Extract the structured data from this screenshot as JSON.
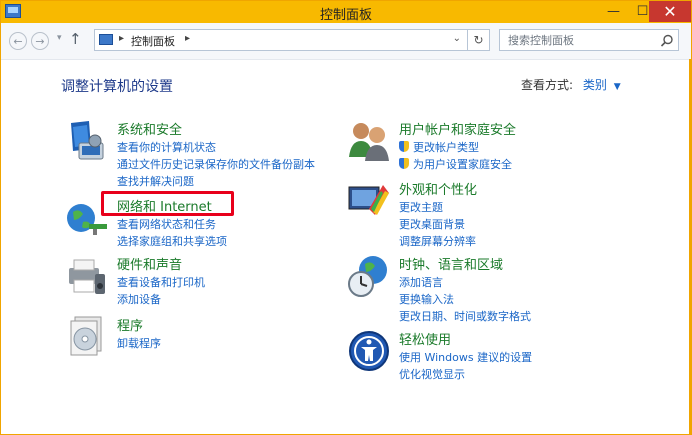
{
  "window": {
    "title": "控制面板",
    "buttons": {
      "minimize": "—",
      "maximize": "☐",
      "close": "✕"
    }
  },
  "address": {
    "back": "←",
    "forward": "→",
    "recent": "▾",
    "up": "↑",
    "path": "控制面板",
    "separator": "▸",
    "dropdown": "⌄",
    "refresh": "↻",
    "search_placeholder": "搜索控制面板"
  },
  "header": {
    "title": "调整计算机的设置",
    "view_by_label": "查看方式:",
    "view_by_value": "类别",
    "view_by_caret": "▼"
  },
  "categories": [
    {
      "title": "系统和安全",
      "icon": "shield-system-icon",
      "links": [
        "查看你的计算机状态",
        "通过文件历史记录保存你的文件备份副本",
        "查找并解决问题"
      ]
    },
    {
      "title": "网络和 Internet",
      "icon": "network-globe-icon",
      "links": [
        "查看网络状态和任务",
        "选择家庭组和共享选项"
      ]
    },
    {
      "title": "硬件和声音",
      "icon": "printer-speaker-icon",
      "links": [
        "查看设备和打印机",
        "添加设备"
      ]
    },
    {
      "title": "程序",
      "icon": "programs-disc-icon",
      "links": [
        "卸载程序"
      ]
    },
    {
      "title": "用户帐户和家庭安全",
      "icon": "users-icon",
      "links": [
        "更改帐户类型",
        "为用户设置家庭安全"
      ]
    },
    {
      "title": "外观和个性化",
      "icon": "appearance-icon",
      "links": [
        "更改主题",
        "更改桌面背景",
        "调整屏幕分辨率"
      ]
    },
    {
      "title": "时钟、语言和区域",
      "icon": "clock-globe-icon",
      "links": [
        "添加语言",
        "更换输入法",
        "更改日期、时间或数字格式"
      ]
    },
    {
      "title": "轻松使用",
      "icon": "ease-of-access-icon",
      "links": [
        "使用 Windows 建议的设置",
        "优化视觉显示"
      ]
    }
  ],
  "colors": {
    "accent": "#f8b900",
    "link": "#1a66c7",
    "category_title": "#1a7a2a",
    "highlight": "#e8001b"
  }
}
